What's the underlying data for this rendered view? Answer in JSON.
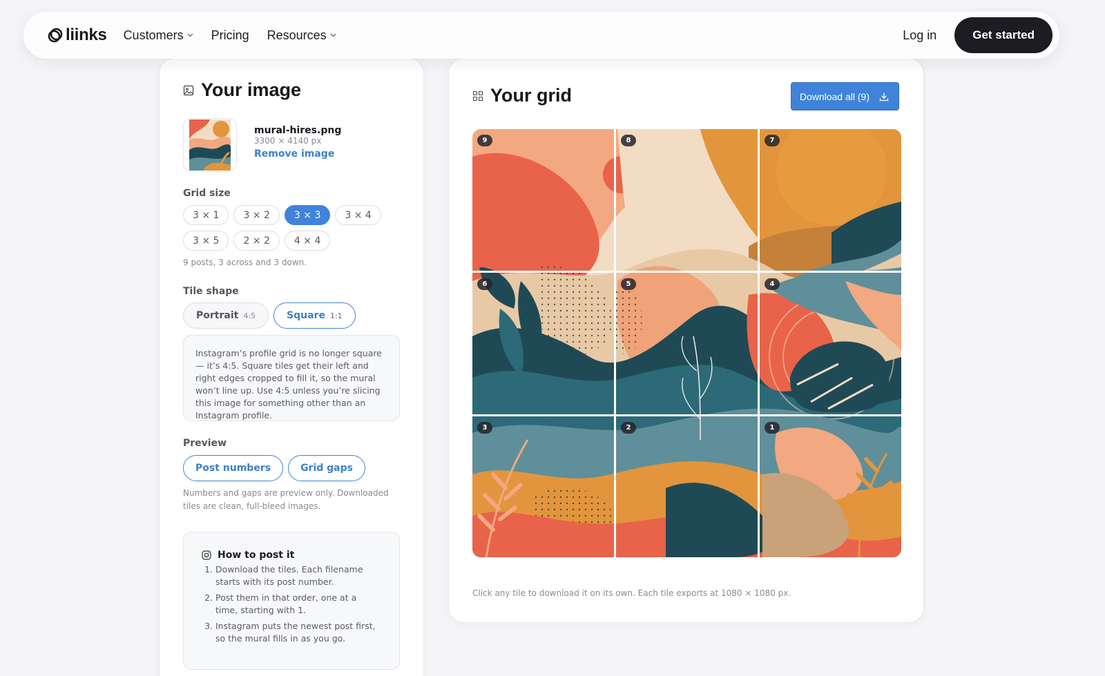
{
  "nav": {
    "brand": "liinks",
    "links": [
      {
        "label": "Customers",
        "dropdown": true
      },
      {
        "label": "Pricing",
        "dropdown": false
      },
      {
        "label": "Resources",
        "dropdown": true
      }
    ],
    "login": "Log in",
    "cta": "Get started"
  },
  "image_panel": {
    "title": "Your image",
    "file": {
      "name": "mural-hires.png",
      "dimensions": "3300 × 4140 px",
      "remove_label": "Remove image"
    },
    "grid_size": {
      "label": "Grid size",
      "options": [
        "3 × 1",
        "3 × 2",
        "3 × 3",
        "3 × 4",
        "3 × 5",
        "2 × 2",
        "4 × 4"
      ],
      "selected": "3 × 3",
      "helper": "9 posts, 3 across and 3 down."
    },
    "tile_shape": {
      "label": "Tile shape",
      "options": [
        {
          "name": "Portrait",
          "ratio": "4:5"
        },
        {
          "name": "Square",
          "ratio": "1:1"
        }
      ],
      "selected": "Square",
      "note": "Instagram’s profile grid is no longer square — it’s 4:5. Square tiles get their left and right edges cropped to fill it, so the mural won’t line up. Use 4:5 unless you’re slicing this image for something other than an Instagram profile."
    },
    "preview": {
      "label": "Preview",
      "toggles": [
        "Post numbers",
        "Grid gaps"
      ],
      "helper": "Numbers and gaps are preview only. Downloaded tiles are clean, full-bleed images."
    },
    "how_to": {
      "title": "How to post it",
      "steps": [
        "Download the tiles. Each filename starts with its post number.",
        "Post them in that order, one at a time, starting with 1.",
        "Instagram puts the newest post first, so the mural fills in as you go."
      ]
    }
  },
  "grid_panel": {
    "title": "Your grid",
    "download_label": "Download all (9)",
    "tile_numbers": [
      "9",
      "8",
      "7",
      "6",
      "5",
      "4",
      "3",
      "2",
      "1"
    ],
    "caption": "Click any tile to download it on its own. Each tile exports at 1080 × 1080 px."
  },
  "colors": {
    "accent": "#3f83da",
    "cta_bg": "#1c1c22",
    "art_palette": [
      "#e8634a",
      "#f2a880",
      "#f3dcc4",
      "#e2953d",
      "#1f4a55",
      "#5f8f9a",
      "#c9a27a"
    ]
  }
}
